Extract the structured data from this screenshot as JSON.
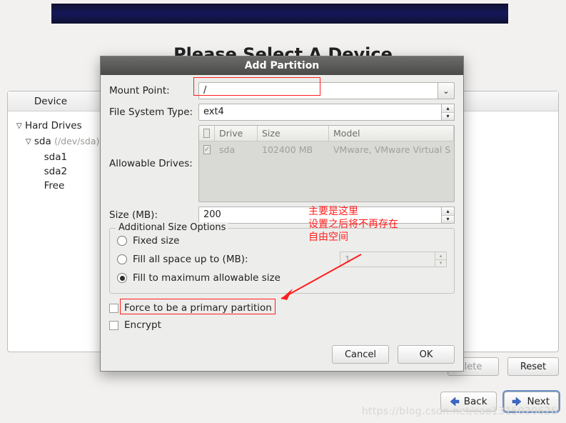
{
  "page": {
    "heading": "Please Select A Device"
  },
  "device_panel": {
    "header_device": "Device",
    "tree": {
      "root": "Hard Drives",
      "disk": "sda",
      "disk_path": "(/dev/sda)",
      "children": [
        "sda1",
        "sda2",
        "Free"
      ]
    },
    "buttons": {
      "delete": "lete",
      "reset": "Reset"
    }
  },
  "nav": {
    "back": "Back",
    "next": "Next"
  },
  "dialog": {
    "title": "Add Partition",
    "mount_point_label": "Mount Point:",
    "mount_point_value": "/",
    "fs_type_label": "File System Type:",
    "fs_type_value": "ext4",
    "allowable_label": "Allowable Drives:",
    "drives_header": {
      "chk": "",
      "drive": "Drive",
      "size": "Size",
      "model": "Model"
    },
    "drives_row": {
      "drive": "sda",
      "size": "102400 MB",
      "model": "VMware, VMware Virtual S"
    },
    "size_label": "Size (MB):",
    "size_value": "200",
    "fieldset_legend": "Additional Size Options",
    "radio_fixed": "Fixed size",
    "radio_fillup": "Fill all space up to (MB):",
    "radio_fillup_value": "1",
    "radio_fillmax": "Fill to maximum allowable size",
    "force_primary": "Force to be a primary partition",
    "encrypt": "Encrypt",
    "cancel": "Cancel",
    "ok": "OK"
  },
  "annotation": {
    "line1": "主要是这里",
    "line2": "设置之后将不再存在",
    "line3": "自由空间"
  },
  "watermark": "https://blog.csdn.net/cao1315020626"
}
